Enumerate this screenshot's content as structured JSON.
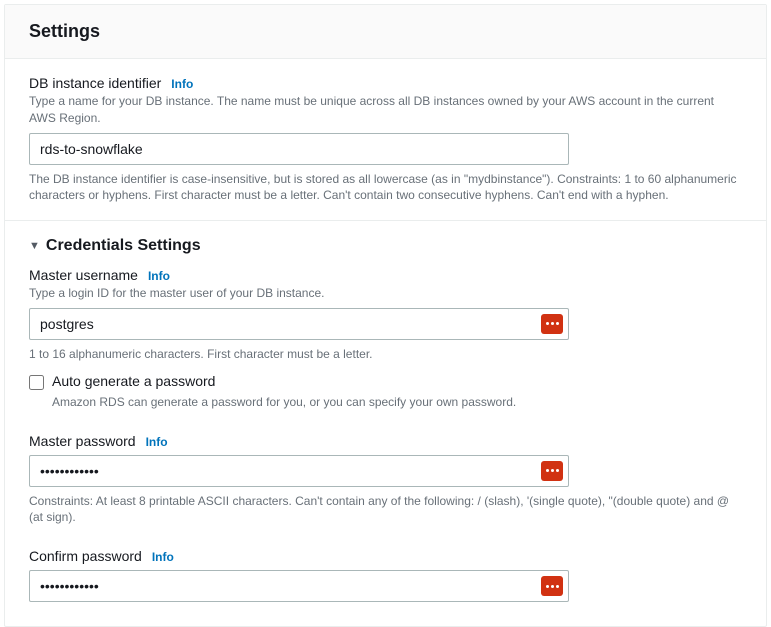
{
  "panel": {
    "title": "Settings"
  },
  "dbInstance": {
    "label": "DB instance identifier",
    "info": "Info",
    "desc": "Type a name for your DB instance. The name must be unique across all DB instances owned by your AWS account in the current AWS Region.",
    "value": "rds-to-snowflake",
    "constraints": "The DB instance identifier is case-insensitive, but is stored as all lowercase (as in \"mydbinstance\"). Constraints: 1 to 60 alphanumeric characters or hyphens. First character must be a letter. Can't contain two consecutive hyphens. Can't end with a hyphen."
  },
  "credentials": {
    "header": "Credentials Settings",
    "masterUsername": {
      "label": "Master username",
      "info": "Info",
      "desc": "Type a login ID for the master user of your DB instance.",
      "value": "postgres",
      "constraints": "1 to 16 alphanumeric characters. First character must be a letter."
    },
    "autoGenerate": {
      "label": "Auto generate a password",
      "desc": "Amazon RDS can generate a password for you, or you can specify your own password."
    },
    "masterPassword": {
      "label": "Master password",
      "info": "Info",
      "value": "••••••••••••",
      "constraints": "Constraints: At least 8 printable ASCII characters. Can't contain any of the following: / (slash), '(single quote), \"(double quote) and @ (at sign)."
    },
    "confirmPassword": {
      "label": "Confirm password",
      "info": "Info",
      "value": "••••••••••••"
    }
  }
}
